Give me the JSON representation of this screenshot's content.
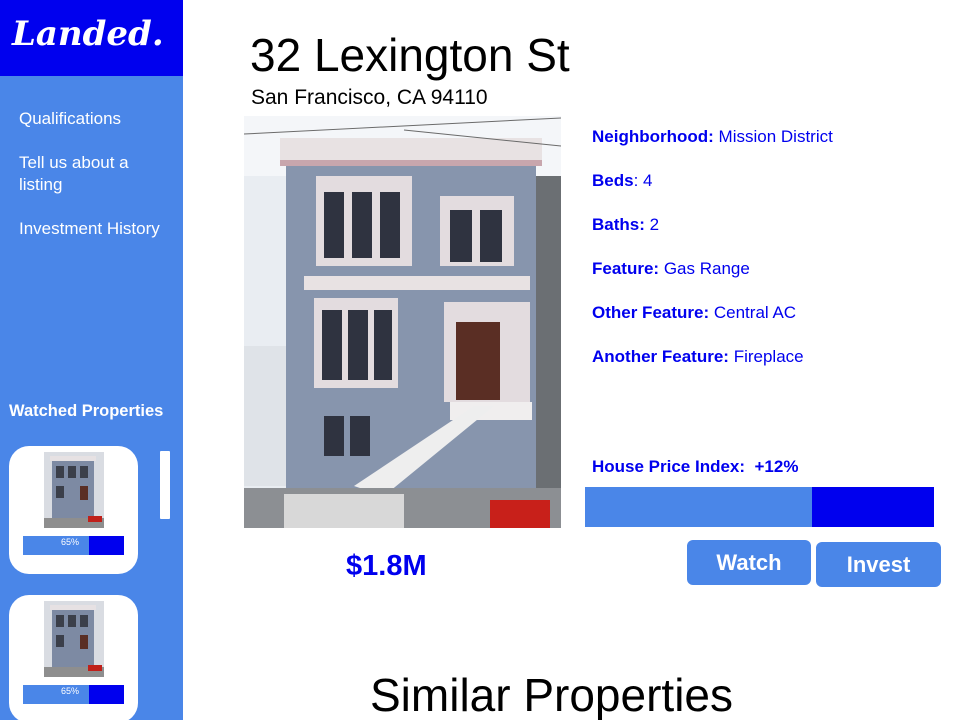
{
  "brand": {
    "logo_text": "Landed."
  },
  "sidebar": {
    "nav": [
      {
        "label": "Qualifications"
      },
      {
        "label": "Tell us about a listing"
      },
      {
        "label": "Investment History"
      }
    ],
    "watched_title": "Watched Properties",
    "watched": [
      {
        "progress_label": "65%",
        "progress": 0.65
      },
      {
        "progress_label": "65%",
        "progress": 0.65
      }
    ]
  },
  "listing": {
    "address": "32 Lexington St",
    "city_line": "San Francisco, CA 94110",
    "price": "$1.8M",
    "details": [
      {
        "label": "Neighborhood:",
        "value": "Mission District"
      },
      {
        "label": "Beds",
        "value": "4"
      },
      {
        "label": "Baths:",
        "value": "2"
      },
      {
        "label": "Feature:",
        "value": "Gas Range"
      },
      {
        "label": "Other Feature:",
        "value": "Central AC"
      },
      {
        "label": "Another Feature:",
        "value": "Fireplace"
      }
    ],
    "hpi_label": "House Price Index:  +12%",
    "hpi_progress": 0.65
  },
  "actions": {
    "watch_label": "Watch",
    "invest_label": "Invest"
  },
  "similar_title": "Similar Properties",
  "colors": {
    "accent": "#4a86e8",
    "primary": "#0000ee"
  }
}
